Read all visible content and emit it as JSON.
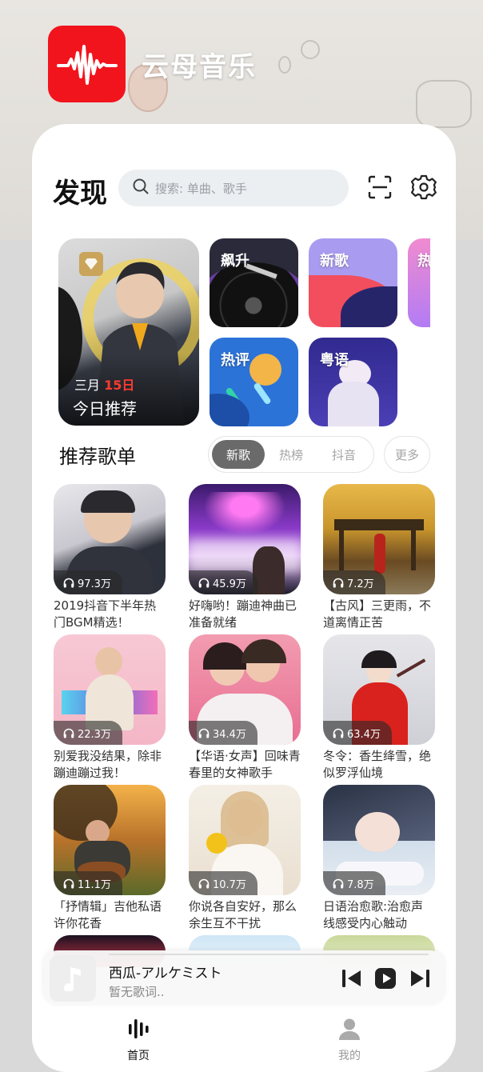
{
  "app": {
    "name": "云母音乐",
    "accent": "#f2141c"
  },
  "header": {
    "title": "发现",
    "search_placeholder": "搜索: 单曲、歌手"
  },
  "featured": {
    "month": "三月",
    "day": "15日",
    "title": "今日推荐"
  },
  "categories": [
    {
      "label": "飙升"
    },
    {
      "label": "新歌"
    },
    {
      "label": "热"
    },
    {
      "label": "热评"
    },
    {
      "label": "粤语"
    }
  ],
  "playlists_section": {
    "title": "推荐歌单",
    "tabs": [
      "新歌",
      "热榜",
      "抖音"
    ],
    "active_tab": "新歌",
    "more_label": "更多"
  },
  "playlists": [
    {
      "plays": "97.3万",
      "title": "2019抖音下半年热门BGM精选！"
    },
    {
      "plays": "45.9万",
      "title": "好嗨哟！蹦迪神曲已准备就绪"
    },
    {
      "plays": "7.2万",
      "title": "【古风】三更雨，不道离情正苦"
    },
    {
      "plays": "22.3万",
      "title": "别爱我没结果，除非蹦迪蹦过我！"
    },
    {
      "plays": "34.4万",
      "title": "【华语·女声】回味青春里的女神歌手"
    },
    {
      "plays": "63.4万",
      "title": "冬令：香生绛雪，绝似罗浮仙境"
    },
    {
      "plays": "11.1万",
      "title": "「抒情辑」吉他私语许你花香"
    },
    {
      "plays": "10.7万",
      "title": "你说各自安好，那么余生互不干扰"
    },
    {
      "plays": "7.8万",
      "title": "日语治愈歌:治愈声线感受内心触动"
    }
  ],
  "player": {
    "song": "西瓜-アルケミスト",
    "lyric": "暂无歌词.."
  },
  "tabbar": {
    "home": "首页",
    "mine": "我的"
  }
}
